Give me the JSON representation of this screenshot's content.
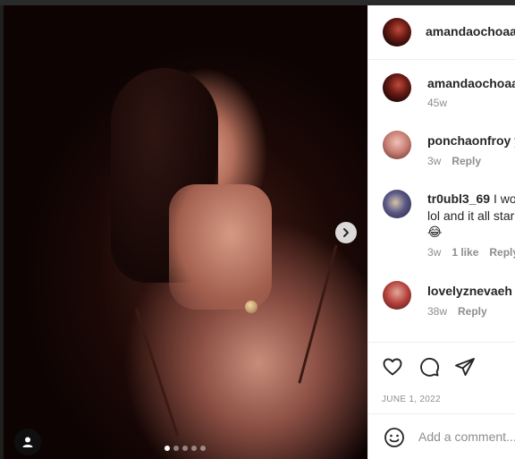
{
  "post": {
    "author": "amandaochoaa",
    "caption_age": "45w",
    "date": "JUNE 1, 2022",
    "carousel": {
      "slide_count": 5,
      "active_slide": 1
    }
  },
  "comments": [
    {
      "username": "ponchaonfroy",
      "text": "y",
      "age": "3w",
      "reply_label": "Reply"
    },
    {
      "username": "tr0ubl3_69",
      "text_line1": "I wo",
      "text_line2": "lol and it all star",
      "emoji": "😂",
      "age": "3w",
      "likes": "1 like",
      "reply_label": "Reply"
    },
    {
      "username": "lovelyznevaeh",
      "emoji": "💗",
      "age": "38w",
      "reply_label": "Reply"
    }
  ],
  "composer": {
    "placeholder": "Add a comment..."
  },
  "icons": {
    "like": "heart-icon",
    "comment": "comment-icon",
    "share": "share-icon",
    "emoji": "emoji-icon",
    "next": "chevron-right-icon",
    "tags": "user-icon"
  },
  "colors": {
    "text": "#262626",
    "muted": "#8e8e8e",
    "divider": "#efefef"
  }
}
